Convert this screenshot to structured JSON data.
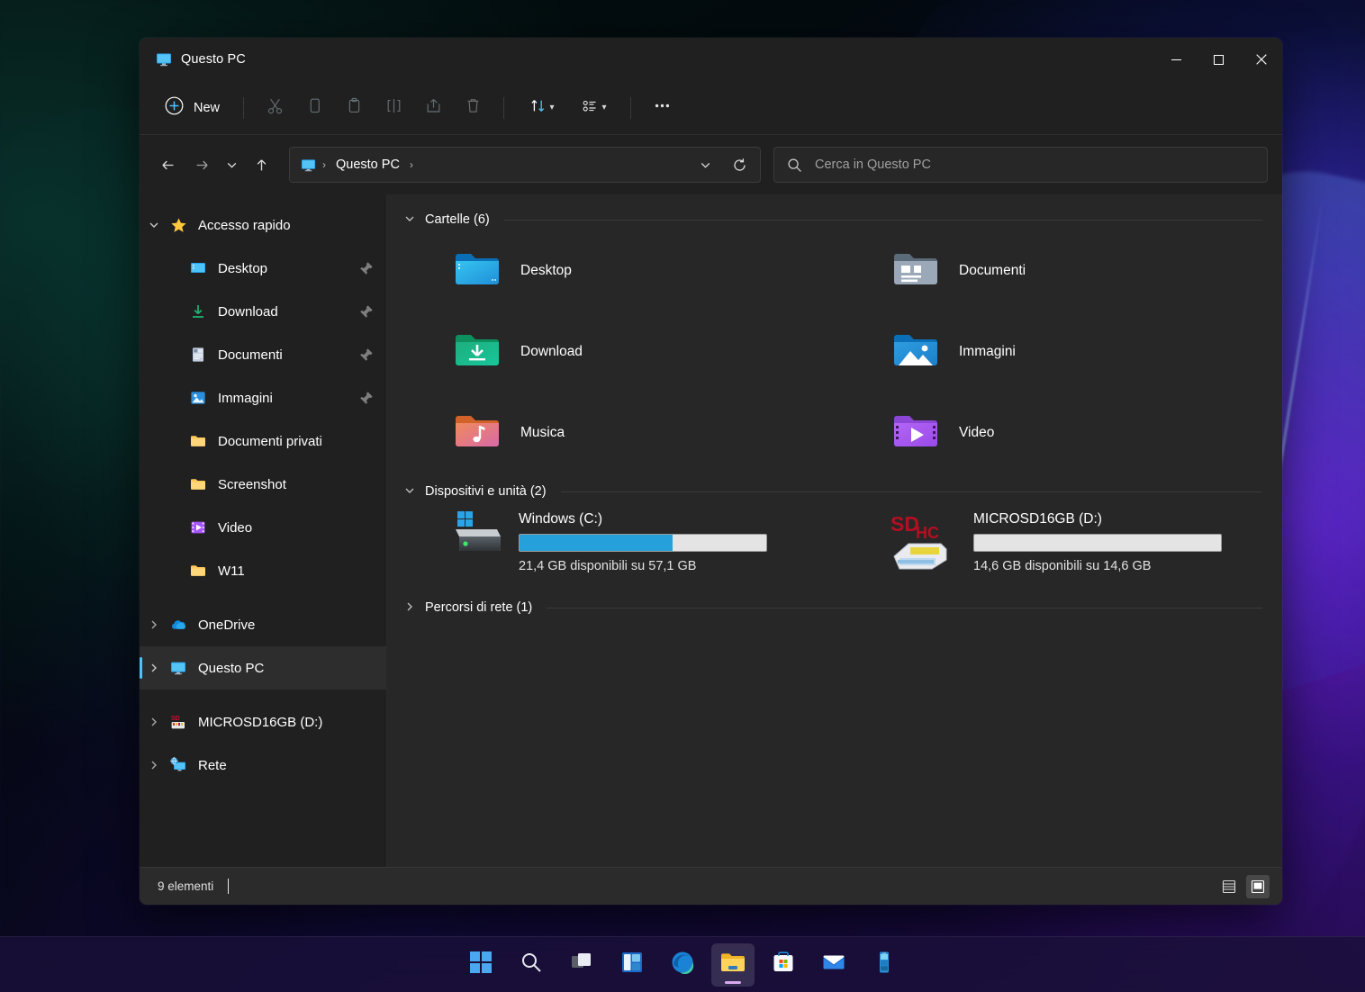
{
  "window": {
    "title": "Questo PC",
    "title_icon": "this-pc-icon",
    "controls": {
      "minimize": "—",
      "maximize": "□",
      "close": "✕"
    }
  },
  "toolbar": {
    "new_label": "New",
    "new_icon": "plus-circle-icon",
    "buttons": [
      {
        "name": "cut-button",
        "icon": "scissors-icon",
        "disabled": true
      },
      {
        "name": "copy-button",
        "icon": "copy-icon",
        "disabled": true
      },
      {
        "name": "paste-button",
        "icon": "clipboard-icon",
        "disabled": true
      },
      {
        "name": "rename-button",
        "icon": "rename-icon",
        "disabled": true
      },
      {
        "name": "share-button",
        "icon": "share-icon",
        "disabled": true
      },
      {
        "name": "delete-button",
        "icon": "trash-icon",
        "disabled": true
      }
    ],
    "sort_icon": "sort-arrows-icon",
    "view_icon": "view-list-icon",
    "overflow_icon": "ellipsis-icon"
  },
  "navigation": {
    "back_icon": "arrow-left-icon",
    "forward_icon": "arrow-right-icon",
    "recent_icon": "chevron-down-icon",
    "up_icon": "arrow-up-icon",
    "breadcrumb_icon": "this-pc-icon",
    "breadcrumb": [
      "Questo PC"
    ],
    "separator": "›",
    "dropdown_icon": "chevron-down-icon",
    "refresh_icon": "refresh-icon"
  },
  "search": {
    "icon": "search-icon",
    "placeholder": "Cerca in Questo PC",
    "value": ""
  },
  "sidebar": {
    "groups": [
      {
        "name": "Accesso rapido",
        "icon": "star-icon",
        "expanded": true,
        "items": [
          {
            "label": "Desktop",
            "icon": "desktop-icon",
            "pinned": true
          },
          {
            "label": "Download",
            "icon": "download-icon",
            "pinned": true
          },
          {
            "label": "Documenti",
            "icon": "document-icon",
            "pinned": true
          },
          {
            "label": "Immagini",
            "icon": "pictures-icon",
            "pinned": true
          },
          {
            "label": "Documenti privati",
            "icon": "folder-icon",
            "pinned": false
          },
          {
            "label": "Screenshot",
            "icon": "folder-icon",
            "pinned": false
          },
          {
            "label": "Video",
            "icon": "video-icon",
            "pinned": false
          },
          {
            "label": "W11",
            "icon": "folder-icon",
            "pinned": false
          }
        ]
      }
    ],
    "roots": [
      {
        "label": "OneDrive",
        "icon": "onedrive-icon",
        "selected": false
      },
      {
        "label": "Questo PC",
        "icon": "this-pc-icon",
        "selected": true
      },
      {
        "label": "MICROSD16GB (D:)",
        "icon": "sdcard-icon",
        "selected": false
      },
      {
        "label": "Rete",
        "icon": "network-icon",
        "selected": false
      }
    ]
  },
  "content": {
    "folders_section": {
      "title": "Cartelle (6)",
      "expanded": true,
      "items": [
        {
          "name": "Desktop",
          "icon": "folder-desktop-icon"
        },
        {
          "name": "Documenti",
          "icon": "folder-documents-icon"
        },
        {
          "name": "Download",
          "icon": "folder-download-icon"
        },
        {
          "name": "Immagini",
          "icon": "folder-pictures-icon"
        },
        {
          "name": "Musica",
          "icon": "folder-music-icon"
        },
        {
          "name": "Video",
          "icon": "folder-video-icon"
        }
      ]
    },
    "drives_section": {
      "title": "Dispositivi e unità (2)",
      "expanded": true,
      "items": [
        {
          "name": "Windows (C:)",
          "icon": "hard-drive-windows-icon",
          "free_text": "21,4 GB disponibili su 57,1 GB",
          "free_gb": 21.4,
          "total_gb": 57.1,
          "used_percent": 62,
          "bar_color": "#26a0da"
        },
        {
          "name": "MICROSD16GB (D:)",
          "icon": "sdhc-card-icon",
          "free_text": "14,6 GB disponibili su 14,6 GB",
          "free_gb": 14.6,
          "total_gb": 14.6,
          "used_percent": 0,
          "bar_color": "#26a0da"
        }
      ]
    },
    "network_section": {
      "title": "Percorsi di rete (1)",
      "expanded": false
    }
  },
  "status_bar": {
    "item_count_text": "9 elementi",
    "views": [
      {
        "name": "details-view-button",
        "icon": "list-view-icon",
        "active": false
      },
      {
        "name": "large-icons-view-button",
        "icon": "large-icon-view",
        "active": true
      }
    ]
  },
  "taskbar": {
    "buttons": [
      {
        "name": "start-button",
        "icon": "windows-logo-icon",
        "active": false
      },
      {
        "name": "search-button",
        "icon": "search-icon",
        "active": false
      },
      {
        "name": "task-view-button",
        "icon": "task-view-icon",
        "active": false
      },
      {
        "name": "widgets-button",
        "icon": "widgets-icon",
        "active": false
      },
      {
        "name": "edge-button",
        "icon": "edge-icon",
        "active": false
      },
      {
        "name": "file-explorer-button",
        "icon": "file-explorer-icon",
        "active": true
      },
      {
        "name": "store-button",
        "icon": "microsoft-store-icon",
        "active": false
      },
      {
        "name": "mail-button",
        "icon": "mail-icon",
        "active": false
      },
      {
        "name": "phone-link-button",
        "icon": "phone-link-icon",
        "active": false
      }
    ]
  },
  "colors": {
    "accent": "#4cc2ff",
    "window_bg": "#202020",
    "content_bg": "#272727",
    "drive_bar": "#26a0da"
  }
}
